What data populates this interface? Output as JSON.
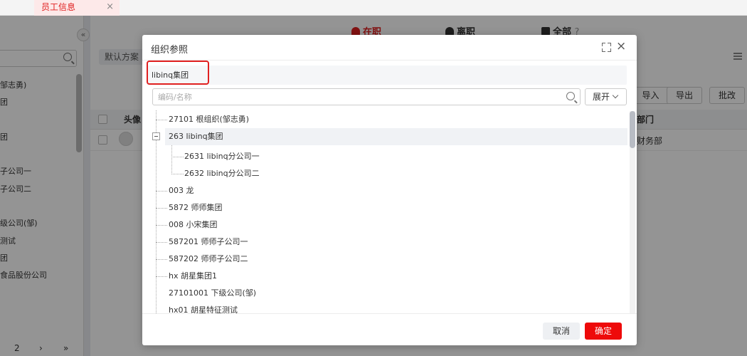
{
  "colors": {
    "accent": "#e02020",
    "ok_button": "#ee0a0a",
    "overlay": "rgba(0,0,0,0.42)"
  },
  "top_tab": {
    "label": "员工信息",
    "close": "×"
  },
  "background": {
    "left_tree": [
      "邹志勇)",
      "团",
      "",
      "团",
      "",
      "子公司一",
      "子公司二",
      "",
      "级公司(邹)",
      "测试",
      "团",
      "食品股份公司"
    ],
    "collapse_glyph": "«",
    "pager": {
      "page": "2",
      "next": "›",
      "last": "»"
    },
    "status_tabs": {
      "active": "在职",
      "left": "离职",
      "all": "全部",
      "help": "?"
    },
    "plan": "默认方案",
    "buttons": {
      "import": "导入",
      "export": "导出",
      "batch": "批改"
    },
    "table": {
      "avatar_header": "头像",
      "dept_header": "部门",
      "row_dept": "财务部"
    }
  },
  "modal": {
    "title": "组织参照",
    "selected": "libinq集团",
    "search_placeholder": "编码/名称",
    "expand_label": "展开",
    "tree": [
      {
        "label": "27101 根组织(邹志勇)"
      },
      {
        "label": "263 libinq集团",
        "expanded": true,
        "selected": true
      },
      {
        "label": "2631 libinq分公司一"
      },
      {
        "label": "2632 libinq分公司二"
      },
      {
        "label": "003 龙"
      },
      {
        "label": "5872 师师集团"
      },
      {
        "label": "008 小宋集团"
      },
      {
        "label": "587201 师师子公司一"
      },
      {
        "label": "587202 师师子公司二"
      },
      {
        "label": "hx 胡星集团1"
      },
      {
        "label": "27101001 下级公司(邹)"
      },
      {
        "label": "hx01 胡星特征测试"
      }
    ],
    "cancel": "取消",
    "ok": "确定"
  }
}
